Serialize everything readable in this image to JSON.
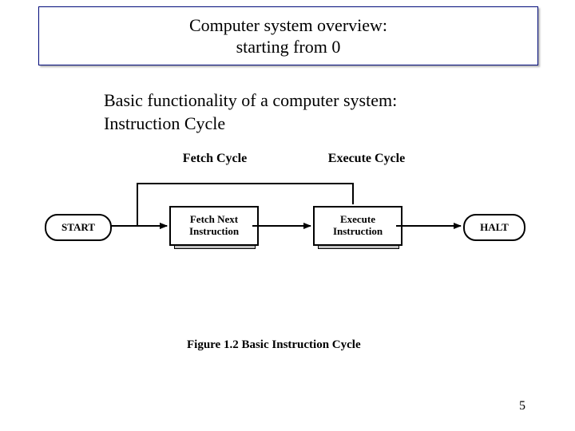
{
  "title": {
    "line1": "Computer system overview:",
    "line2": "starting from 0"
  },
  "body": {
    "line1": "Basic functionality of a computer system:",
    "line2": "Instruction Cycle"
  },
  "figure": {
    "group_labels": {
      "fetch": "Fetch Cycle",
      "execute": "Execute Cycle"
    },
    "nodes": {
      "start": "START",
      "fetch": "Fetch Next\nInstruction",
      "exec": "Execute\nInstruction",
      "halt": "HALT"
    },
    "caption": "Figure 1.2  Basic Instruction Cycle"
  },
  "page_number": "5"
}
